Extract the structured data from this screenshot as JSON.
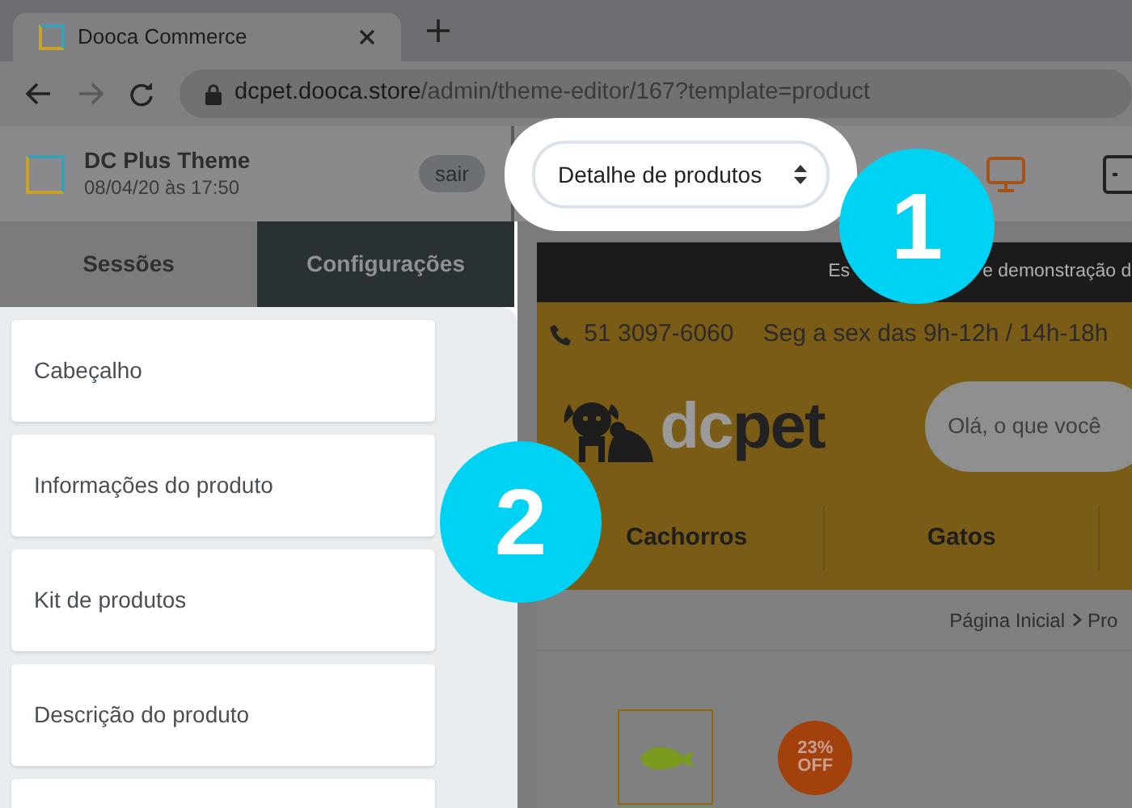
{
  "browser": {
    "tab_title": "Dooca Commerce",
    "url_host": "dcpet.dooca.store",
    "url_path": "/admin/theme-editor/167?template=product"
  },
  "theme": {
    "name": "DC Plus Theme",
    "date": "08/04/20 às 17:50",
    "logout": "sair"
  },
  "template_select": {
    "value": "Detalhe de produtos"
  },
  "sidebar": {
    "tabs": [
      {
        "label": "Sessões",
        "selected": true
      },
      {
        "label": "Configurações",
        "selected": false
      }
    ],
    "items": [
      {
        "label": "Cabeçalho"
      },
      {
        "label": "Informações do produto"
      },
      {
        "label": "Kit de produtos"
      },
      {
        "label": "Descrição do produto"
      }
    ],
    "more_items": true
  },
  "preview": {
    "notice_parts": [
      "Es",
      "e demonstração d"
    ],
    "phone": "51 3097-6060",
    "hours": "Seg a sex das 9h-12h / 14h-18h",
    "logo": [
      "dc",
      "pet"
    ],
    "search": {
      "placeholder": "Olá, o que você"
    },
    "menu": [
      "Cachorros",
      "Gatos"
    ],
    "breadcrumb": [
      "Página Inicial",
      "Pro"
    ],
    "discount": [
      "23%",
      "OFF"
    ]
  },
  "callouts": [
    "1",
    "2"
  ]
}
